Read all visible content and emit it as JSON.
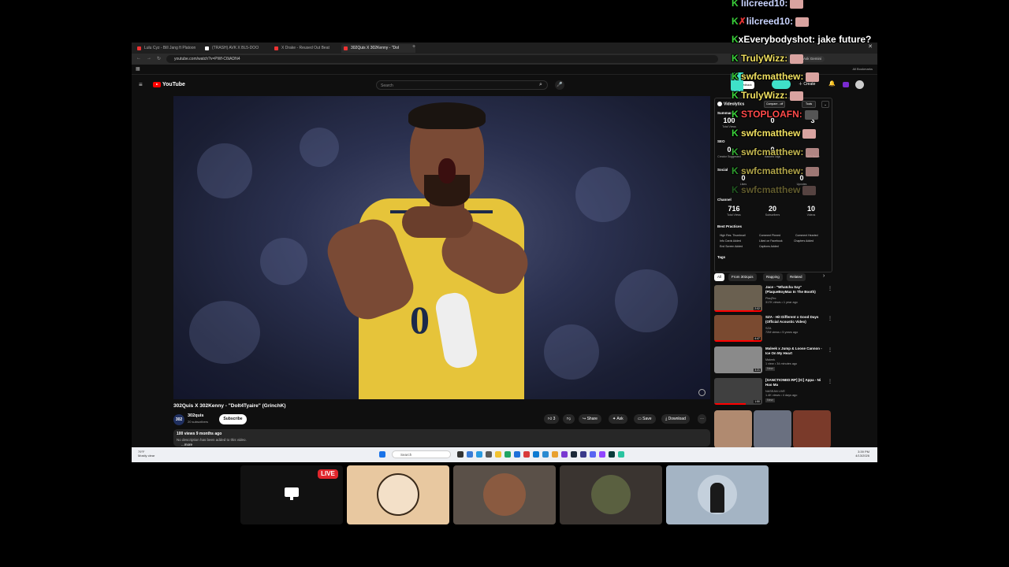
{
  "browser": {
    "tabs": [
      {
        "label": "Lulu Cyz - Bill Jang ft Platoon"
      },
      {
        "label": "(TRASH) AVK X BL5-DOO"
      },
      {
        "label": "X Drake - Reused Out Beat"
      },
      {
        "label": "302Quis X 302Kenny - \"Dol"
      }
    ],
    "url": "youtube.com/watch?v=PWf-C6tADN4",
    "all_bookmarks": "All Bookmarks",
    "ask_gemini": "Ask Gemini"
  },
  "youtube": {
    "logo": "YouTube",
    "search_placeholder": "Search",
    "create_label": "Create",
    "live_feedback": "Live feedback",
    "video": {
      "title": "302Quis X 302Kenny - \"DoIt4Tyaire\" (GrinchK)",
      "channel": "302quis",
      "channel_avatar": "302",
      "subscribers": "20 subscribers",
      "subscribe_label": "Subscribe",
      "likes": "3",
      "share_label": "Share",
      "ask_label": "Ask",
      "save_label": "Save",
      "download_label": "Download",
      "views_date": "100 views  9 months ago",
      "description": "No description has been added to this video.",
      "more_label": "...more"
    },
    "videolytics": {
      "name": "Videolytics",
      "compare": "Compare - off",
      "tools": "Tools",
      "summary_label": "Summary",
      "summary": [
        {
          "value": "100",
          "label": "Total Views"
        },
        {
          "value": "0",
          "label": ""
        },
        {
          "value": "3",
          "label": ""
        }
      ],
      "seo_label": "SEO",
      "seo": [
        {
          "value": "0",
          "label": "Creator Suggested"
        },
        {
          "value": "0",
          "label": "Ranked Tags"
        },
        {
          "value": "",
          "label": "SEO Score"
        }
      ],
      "social_label": "Social",
      "social": [
        {
          "value": "0",
          "label": "Likes"
        },
        {
          "value": "0",
          "label": "Upvotes"
        }
      ],
      "channel_label": "Channel",
      "channel": [
        {
          "value": "716",
          "label": "Total Views"
        },
        {
          "value": "20",
          "label": "Subscribers"
        },
        {
          "value": "10",
          "label": "Videos"
        }
      ],
      "best_practices_label": "Best Practices",
      "best_practices": [
        "High Res. Thumbnail",
        "Comment Pinned",
        "Comment Hearted",
        "Info Cards Added",
        "Liked on Facebook",
        "Chapters Added",
        "End Screen Added",
        "Captions Added"
      ],
      "tags_label": "Tags"
    },
    "chips": [
      "All",
      "From 302quis",
      "Rapping",
      "Related"
    ],
    "recommendations": [
      {
        "title": "Jace - \"Whatcha Say\" (PlaqueBoyMax In The Booth)",
        "channel": "PlaqTec",
        "meta": "317K views • 1 year ago",
        "duration": "2:02",
        "thumb_color": "#6a6050"
      },
      {
        "title": "SZA - Hit Different x Good Days (Official Acoustic Video)",
        "channel": "SZA",
        "meta": "72M views • 5 years ago",
        "duration": "4:47",
        "thumb_color": "#7a4a30"
      },
      {
        "title": "Maleek x Jump & Loose Cannon - Ice On My Heart",
        "channel": "Maleek",
        "meta": "1 view • 34 minutes ago",
        "duration": "3:21",
        "badge": "New",
        "thumb_color": "#8a8a8a"
      },
      {
        "title": "[SANCTIONED:RP] [IC] Appa - Ni Hao Ma",
        "channel": "NASEAN LIVE",
        "meta": "1.4K views • 4 days ago",
        "duration": "1:50",
        "badge": "New",
        "thumb_color": "#404040"
      }
    ]
  },
  "taskbar": {
    "weather_temp": "79°F",
    "weather_desc": "Mostly clear",
    "search_placeholder": "Search",
    "time": "3:39 PM",
    "date": "4/13/2026"
  },
  "chat": [
    {
      "user": "lilcreed10:",
      "message": "",
      "emote": true,
      "prefix": "K"
    },
    {
      "user": "lilcreed10:",
      "message": "",
      "emote": true,
      "prefix": "K",
      "red_x": true
    },
    {
      "user": "xEverybodyshot:",
      "message": "jake future?",
      "emote": false,
      "prefix": "K"
    },
    {
      "user": "TrulyWizz:",
      "message": "",
      "emote": true,
      "prefix": "K"
    },
    {
      "user": "swfcmatthew:",
      "message": "",
      "emote": true,
      "prefix": "K"
    },
    {
      "user": "TrulyWizz:",
      "message": "",
      "emote": true,
      "prefix": "K"
    },
    {
      "user": "STOPLOAFN:",
      "message": "",
      "emote": true,
      "prefix": "K",
      "red_name": true
    },
    {
      "user": "swfcmatthew",
      "message": "",
      "emote": true,
      "prefix": "K"
    },
    {
      "user": "swfcmatthew:",
      "message": "",
      "emote": true,
      "prefix": "K"
    },
    {
      "user": "swfcmatthew:",
      "message": "",
      "emote": true,
      "prefix": "K"
    },
    {
      "user": "swfcmatthew",
      "message": "",
      "emote": true,
      "prefix": "K"
    }
  ],
  "stream": {
    "live_label": "LIVE"
  },
  "colors": {
    "chat_green": "#3ad13a",
    "youtube_red": "#ff0000",
    "live_red": "#e0262c",
    "ext_teal": "#3fe0c8"
  }
}
